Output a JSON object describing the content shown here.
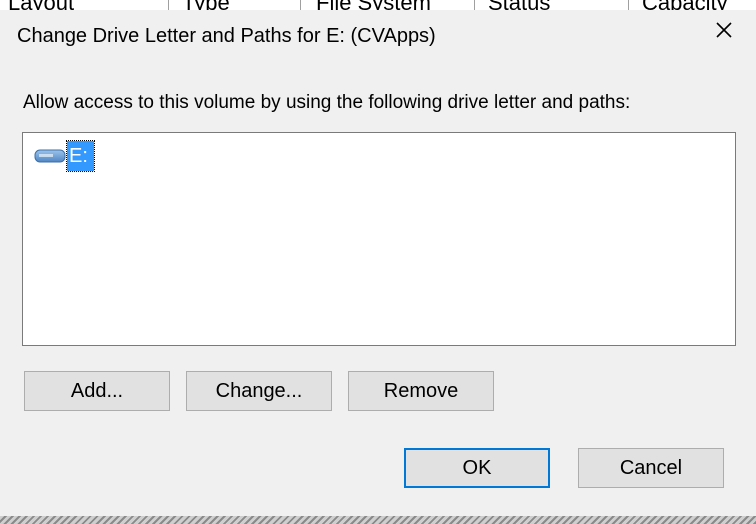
{
  "background": {
    "columns": [
      "Layout",
      "Type",
      "File System",
      "Status",
      "Capacity"
    ]
  },
  "dialog": {
    "title": "Change Drive Letter and Paths for E: (CVApps)",
    "instruction": "Allow access to this volume by using the following drive letter and paths:",
    "list": {
      "items": [
        {
          "label": "E:",
          "icon": "drive-icon",
          "selected": true
        }
      ]
    },
    "buttons": {
      "add": "Add...",
      "change": "Change...",
      "remove": "Remove",
      "ok": "OK",
      "cancel": "Cancel"
    }
  },
  "colors": {
    "selection": "#3399ff",
    "focus_border": "#0078d7",
    "dialog_bg": "#f0f0f0"
  }
}
